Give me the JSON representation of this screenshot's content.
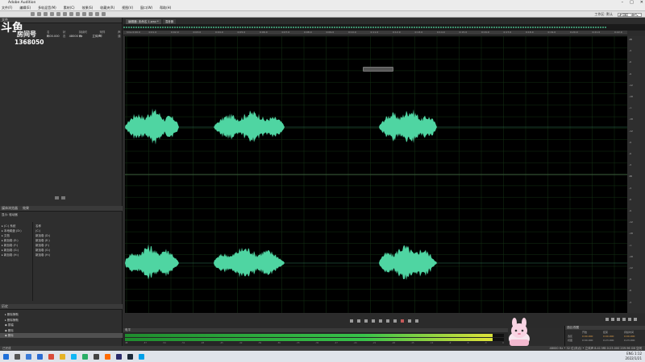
{
  "window": {
    "title": "Adobe Audition"
  },
  "menu": [
    "文件(F)",
    "编辑(E)",
    "多轨混音(M)",
    "素材(C)",
    "效果(S)",
    "收藏夹(R)",
    "视图(V)",
    "窗口(W)",
    "帮助(H)"
  ],
  "toolbar": {
    "workspace_label": "工作区: 默认",
    "search_placeholder": "搜索帮助"
  },
  "overlay": {
    "logo_text": "房间号",
    "room_number": "1368050"
  },
  "files_panel": {
    "tab_label": "文件",
    "columns": [
      "名称",
      "状态",
      "持续时间",
      "采样率",
      "声道"
    ],
    "row": [
      "",
      "",
      "0:00.000",
      "48000 Hz",
      "立体声"
    ]
  },
  "media_panel": {
    "tabs": [
      "媒体浏览器",
      "效果"
    ],
    "dropdown": "显示: 驱动器",
    "tree_left": [
      "▸ (C:) 系统",
      "▸ 本地磁盘 (D:)",
      "▸ 文档",
      "▸ 新加卷 (E:)",
      "▸ 新加卷 (F:)",
      "▸ 新加卷 (G:)",
      "▸ 新加卷 (H:)"
    ],
    "tree_right": [
      "名称",
      "(C:)",
      "新加卷 (D:)",
      "新加卷 (E:)",
      "新加卷 (F:)",
      "新加卷 (G:)",
      "新加卷 (H:)"
    ]
  },
  "history_panel": {
    "tab_label": "历史",
    "items": [
      "▸ 删除静默",
      "▸ 删除静默",
      "◆ 振幅",
      "◆ 删除",
      "◆ 删除"
    ]
  },
  "editor": {
    "tabs": [
      "编辑器: 未命名 1.wav *",
      "混音器"
    ],
    "ruler_labels": [
      "hms 0:00.0",
      "0:01.0",
      "0:02.0",
      "0:03.0",
      "0:04.0",
      "0:05.0",
      "0:06.0",
      "0:07.0",
      "0:08.0",
      "0:09.0",
      "0:10.0",
      "0:11.0",
      "0:12.0",
      "0:13.0",
      "0:14.0",
      "0:15.0",
      "0:16.0",
      "0:17.0",
      "0:18.0",
      "0:19.0",
      "0:20.0",
      "0:21.0",
      "0:22.0"
    ],
    "db_labels": [
      "dB",
      "-3",
      "-6",
      "-9",
      "-12",
      "-18",
      "-∞",
      "-18",
      "-12",
      "-9",
      "-6",
      "-3",
      "dB",
      "-3",
      "-6",
      "-9",
      "-12",
      "-18",
      "-∞",
      "-18",
      "-12",
      "-9",
      "-6",
      "-3"
    ],
    "waveform_color": "#4fd5a2",
    "background": "#000000"
  },
  "meter": {
    "tab_label": "电平",
    "level_percent": 97,
    "ticks": [
      "dB",
      "-57",
      "-54",
      "-51",
      "-48",
      "-45",
      "-42",
      "-39",
      "-36",
      "-33",
      "-30",
      "-27",
      "-24",
      "-21",
      "-18",
      "-15",
      "-12",
      "-9",
      "-6",
      "-3",
      "0"
    ]
  },
  "selection_panel": {
    "tab_label": "选区/视图",
    "headers": [
      "",
      "开始",
      "结束",
      "持续时间"
    ],
    "rows": [
      [
        "选区",
        "0:00.000",
        "0:00.000",
        "0:00.000"
      ],
      [
        "视图",
        "0:00.000",
        "0:23.000",
        "0:23.000"
      ]
    ]
  },
  "statusbar": {
    "left": "已完成",
    "right": "48000 Hz • 32 位(浮点) • 立体声   8.41 MB   0:23.000   209.96 GB 空闲"
  },
  "taskbar": {
    "time": "1:12",
    "date": "2022/1/21",
    "tray_text": "ENG"
  }
}
